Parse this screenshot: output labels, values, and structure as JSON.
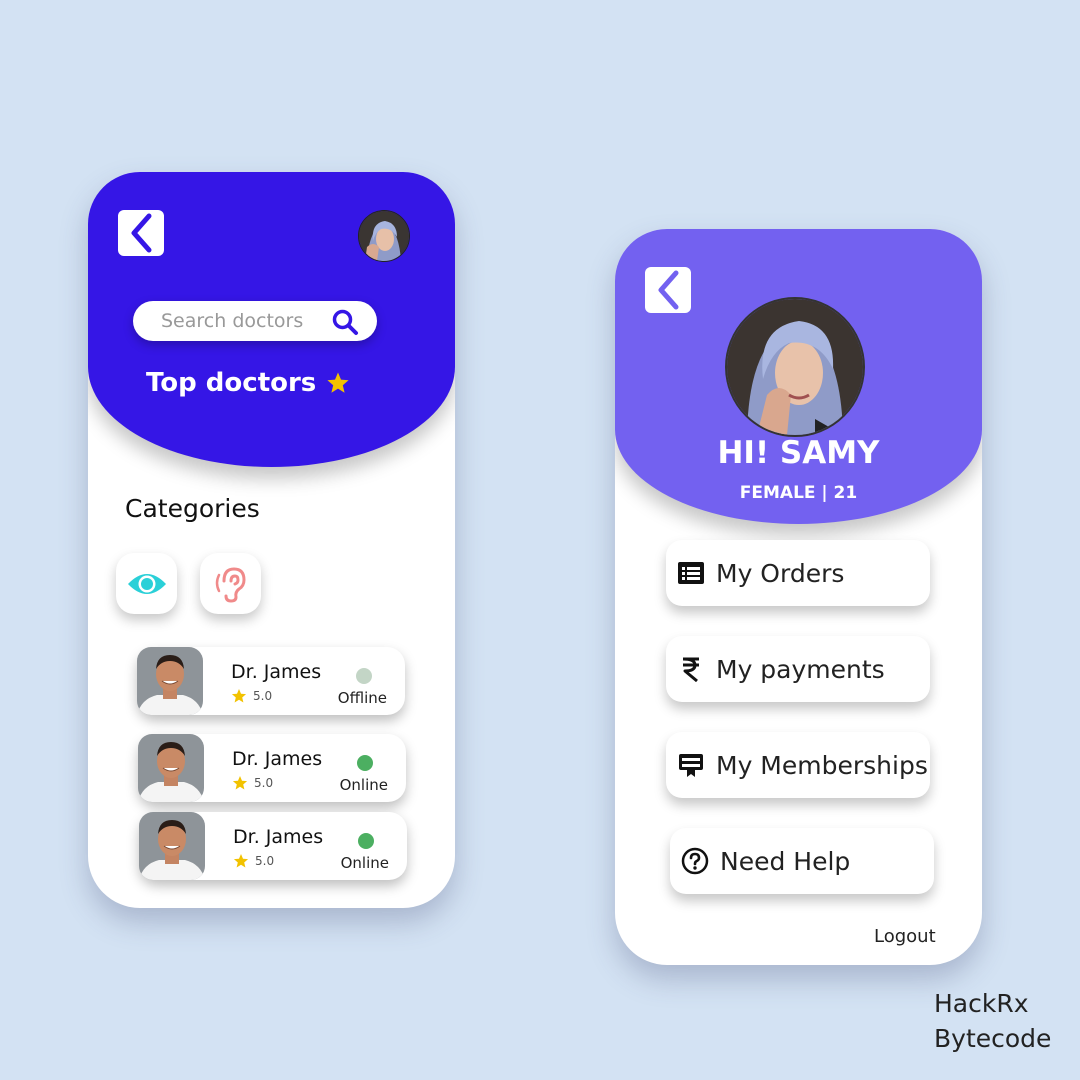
{
  "left_screen": {
    "search": {
      "placeholder": "Search doctors"
    },
    "title": "Top doctors",
    "categories_title": "Categories",
    "categories": [
      {
        "icon": "eye-icon",
        "color": "#2ad0d8"
      },
      {
        "icon": "ear-icon",
        "color": "#f08a8a"
      }
    ],
    "doctors": [
      {
        "name": "Dr. James",
        "rating": "5.0",
        "status": "Offline",
        "status_color": "#c3d5c6"
      },
      {
        "name": "Dr. James",
        "rating": "5.0",
        "status": "Online",
        "status_color": "#4caf61"
      },
      {
        "name": "Dr. James",
        "rating": "5.0",
        "status": "Online",
        "status_color": "#4caf61"
      }
    ]
  },
  "right_screen": {
    "greeting": "HI! SAMY",
    "subinfo": "FEMALE | 21",
    "menu": [
      {
        "label": "My Orders",
        "icon": "list-icon"
      },
      {
        "label": "My payments",
        "icon": "rupee-icon"
      },
      {
        "label": "My Memberships",
        "icon": "membership-card-icon"
      },
      {
        "label": "Need Help",
        "icon": "help-circle-icon"
      }
    ],
    "logout": "Logout"
  },
  "colors": {
    "left_header": "#3516e6",
    "right_header": "#7361f0",
    "star": "#f2c200",
    "background": "#d3e2f3"
  },
  "brand": {
    "line1": "HackRx",
    "line2": "Bytecode"
  }
}
